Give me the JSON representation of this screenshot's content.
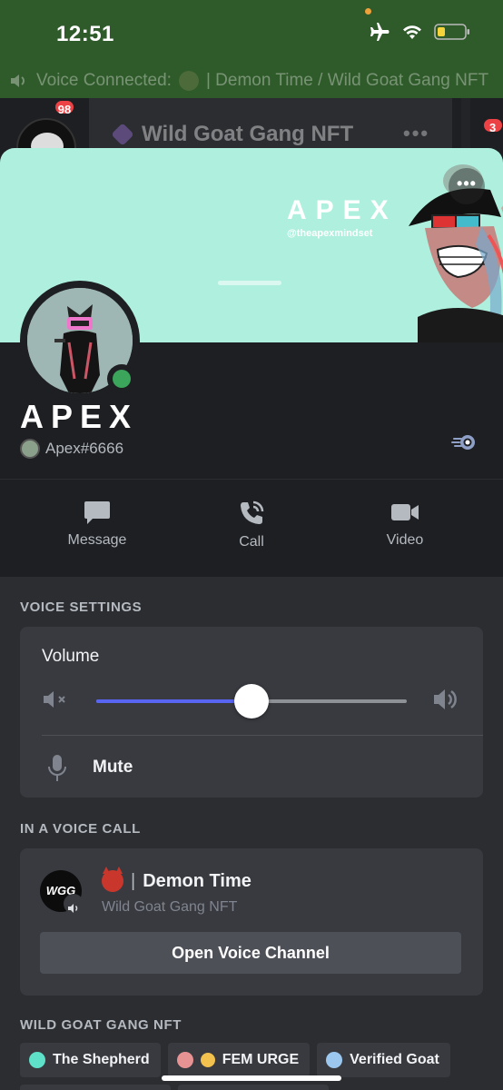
{
  "status_bar": {
    "time": "12:51",
    "icons": [
      "airplane-icon",
      "wifi-icon",
      "battery-icon"
    ],
    "battery_color": "#f5d33b"
  },
  "voice_connected": {
    "prefix": "Voice Connected:",
    "channel": "| Demon Time / Wild Goat Gang NFT"
  },
  "background_app": {
    "badge_count": "98",
    "server_title": "Wild Goat Gang NFT",
    "right_badge": "3"
  },
  "profile": {
    "banner_brand": "APEX",
    "banner_handle": "@theapexmindset",
    "display_name": "APEX",
    "username": "Apex#6666",
    "status_color": "#3ba55c",
    "banner_color": "#aef0dd"
  },
  "actions": {
    "message": "Message",
    "call": "Call",
    "video": "Video"
  },
  "voice_settings": {
    "title": "VOICE SETTINGS",
    "volume_label": "Volume",
    "volume_level": 0.5,
    "mute_label": "Mute",
    "accent": "#5865f2"
  },
  "voice_call": {
    "title": "IN A VOICE CALL",
    "server_avatar_text": "WGG",
    "channel_separator": "|",
    "channel_name": "Demon Time",
    "server_name": "Wild Goat Gang NFT",
    "open_button": "Open Voice Channel"
  },
  "roles_section": {
    "title": "WILD GOAT GANG NFT",
    "roles": [
      {
        "name": "The Shepherd",
        "color": "#5fe0c8"
      },
      {
        "name": "FEM URGE",
        "color": "#e89393"
      },
      {
        "name": "Verified Goat",
        "color": "#9cc8f0"
      }
    ]
  }
}
